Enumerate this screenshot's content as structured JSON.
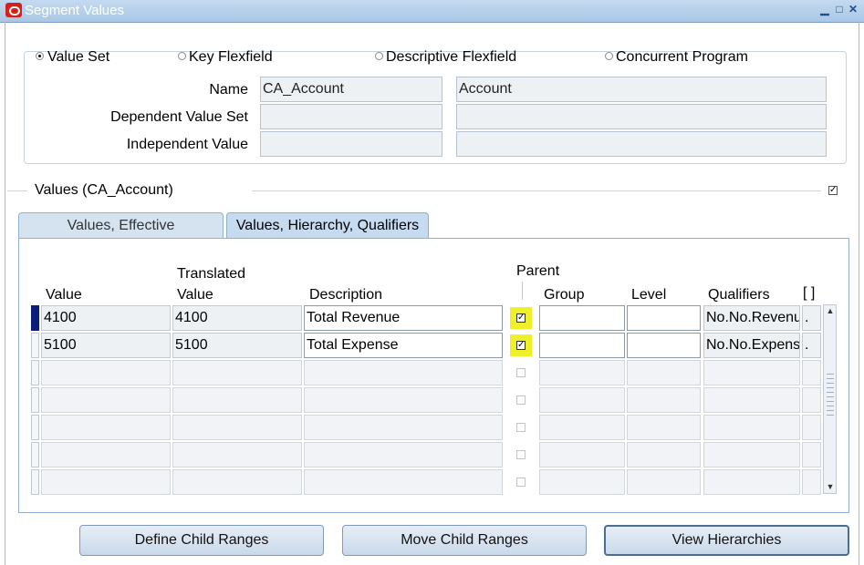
{
  "window": {
    "title": "Segment Values"
  },
  "options": {
    "value_set": "Value Set",
    "key_flexfield": "Key Flexfield",
    "descriptive_flexfield": "Descriptive Flexfield",
    "concurrent_program": "Concurrent Program",
    "selected": "Value Set"
  },
  "form": {
    "name_label": "Name",
    "name_value": "CA_Account",
    "name_description": "Account",
    "dependent_label": "Dependent Value Set",
    "dependent_value": "",
    "dependent_description": "",
    "independent_label": "Independent Value",
    "independent_value": "",
    "independent_description": ""
  },
  "values_section": {
    "title": "Values (CA_Account)"
  },
  "tabs": [
    {
      "label": "Values, Effective",
      "active": false
    },
    {
      "label": "Values, Hierarchy, Qualifiers",
      "active": true
    }
  ],
  "columns": {
    "value": "Value",
    "translated_top": "Translated",
    "translated_bottom": "Value",
    "description": "Description",
    "parent": "Parent",
    "group": "Group",
    "level": "Level",
    "qualifiers": "Qualifiers",
    "flex": "[ ]"
  },
  "rows": [
    {
      "value": "4100",
      "translated": "4100",
      "description": "Total Revenue",
      "parent": true,
      "group": "",
      "level": "",
      "qualifiers": "No.No.Revenu",
      "flex": "."
    },
    {
      "value": "5100",
      "translated": "5100",
      "description": "Total Expense",
      "parent": true,
      "group": "",
      "level": "",
      "qualifiers": "No.No.Expens",
      "flex": "."
    }
  ],
  "buttons": {
    "define_child_ranges": "Define Child Ranges",
    "move_child_ranges": "Move Child Ranges",
    "view_hierarchies": "View Hierarchies"
  },
  "colors": {
    "title_bar": "#a9c7e6",
    "highlight": "#f0f02a",
    "current_row": "#0b1f7a"
  }
}
